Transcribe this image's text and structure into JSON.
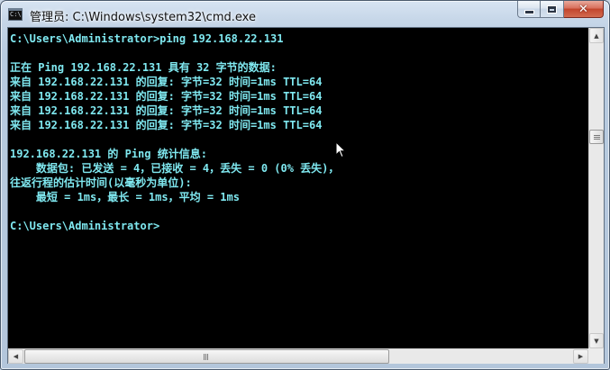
{
  "window": {
    "title": "管理员: C:\\Windows\\system32\\cmd.exe",
    "icon": "cmd-icon",
    "icon_text": "C:\\"
  },
  "console": {
    "text_color": "#7fe8f0",
    "background": "#000000",
    "lines": [
      "C:\\Users\\Administrator>ping 192.168.22.131",
      "",
      "正在 Ping 192.168.22.131 具有 32 字节的数据:",
      "来自 192.168.22.131 的回复: 字节=32 时间=1ms TTL=64",
      "来自 192.168.22.131 的回复: 字节=32 时间=1ms TTL=64",
      "来自 192.168.22.131 的回复: 字节=32 时间=1ms TTL=64",
      "来自 192.168.22.131 的回复: 字节=32 时间=1ms TTL=64",
      "",
      "192.168.22.131 的 Ping 统计信息:",
      "    数据包: 已发送 = 4，已接收 = 4，丢失 = 0 (0% 丢失)，",
      "往返行程的估计时间(以毫秒为单位):",
      "    最短 = 1ms，最长 = 1ms，平均 = 1ms",
      "",
      "C:\\Users\\Administrator>"
    ]
  }
}
